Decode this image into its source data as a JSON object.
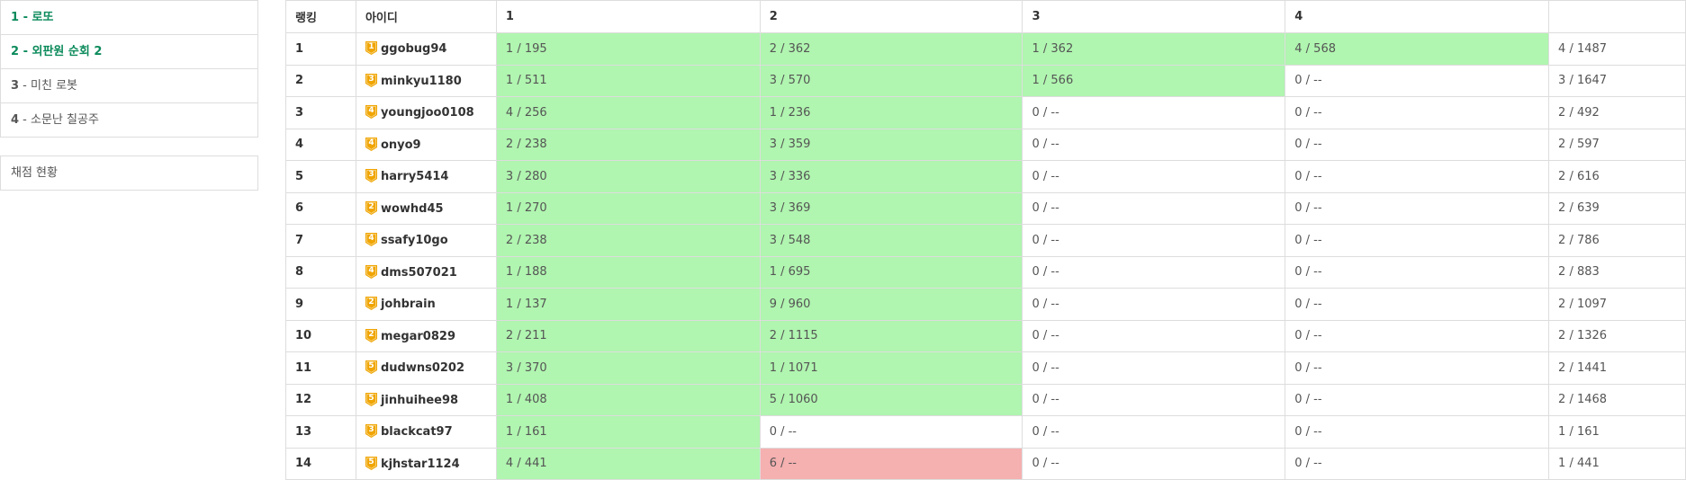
{
  "sidebar": {
    "problems": [
      {
        "num": "1",
        "sep": " - ",
        "title": "로또",
        "solved": true
      },
      {
        "num": "2",
        "sep": " - ",
        "title": "외판원 순회 2",
        "solved": true
      },
      {
        "num": "3",
        "sep": " - ",
        "title": "미친 로봇",
        "solved": false
      },
      {
        "num": "4",
        "sep": " - ",
        "title": "소문난 칠공주",
        "solved": false
      }
    ],
    "status_label": "채점 현황"
  },
  "colors": {
    "accepted": "#b0f5b0",
    "wrong": "#f5b0b0",
    "solved_text": "#0b8a5b",
    "tier_badge": "#f0a500"
  },
  "board": {
    "headers": [
      "랭킹",
      "아이디",
      "1",
      "2",
      "3",
      "4",
      ""
    ],
    "rows": [
      {
        "rank": "1",
        "tier": "1",
        "user": "ggobug94",
        "cells": [
          {
            "text": "1 / 195",
            "status": "ok"
          },
          {
            "text": "2 / 362",
            "status": "ok"
          },
          {
            "text": "1 / 362",
            "status": "ok"
          },
          {
            "text": "4 / 568",
            "status": "ok"
          }
        ],
        "total": "4 / 1487"
      },
      {
        "rank": "2",
        "tier": "3",
        "user": "minkyu1180",
        "cells": [
          {
            "text": "1 / 511",
            "status": "ok"
          },
          {
            "text": "3 / 570",
            "status": "ok"
          },
          {
            "text": "1 / 566",
            "status": "ok"
          },
          {
            "text": "0 / --",
            "status": ""
          }
        ],
        "total": "3 / 1647"
      },
      {
        "rank": "3",
        "tier": "4",
        "user": "youngjoo0108",
        "cells": [
          {
            "text": "4 / 256",
            "status": "ok"
          },
          {
            "text": "1 / 236",
            "status": "ok"
          },
          {
            "text": "0 / --",
            "status": ""
          },
          {
            "text": "0 / --",
            "status": ""
          }
        ],
        "total": "2 / 492"
      },
      {
        "rank": "4",
        "tier": "4",
        "user": "onyo9",
        "cells": [
          {
            "text": "2 / 238",
            "status": "ok"
          },
          {
            "text": "3 / 359",
            "status": "ok"
          },
          {
            "text": "0 / --",
            "status": ""
          },
          {
            "text": "0 / --",
            "status": ""
          }
        ],
        "total": "2 / 597"
      },
      {
        "rank": "5",
        "tier": "3",
        "user": "harry5414",
        "cells": [
          {
            "text": "3 / 280",
            "status": "ok"
          },
          {
            "text": "3 / 336",
            "status": "ok"
          },
          {
            "text": "0 / --",
            "status": ""
          },
          {
            "text": "0 / --",
            "status": ""
          }
        ],
        "total": "2 / 616"
      },
      {
        "rank": "6",
        "tier": "2",
        "user": "wowhd45",
        "cells": [
          {
            "text": "1 / 270",
            "status": "ok"
          },
          {
            "text": "3 / 369",
            "status": "ok"
          },
          {
            "text": "0 / --",
            "status": ""
          },
          {
            "text": "0 / --",
            "status": ""
          }
        ],
        "total": "2 / 639"
      },
      {
        "rank": "7",
        "tier": "4",
        "user": "ssafy10go",
        "cells": [
          {
            "text": "2 / 238",
            "status": "ok"
          },
          {
            "text": "3 / 548",
            "status": "ok"
          },
          {
            "text": "0 / --",
            "status": ""
          },
          {
            "text": "0 / --",
            "status": ""
          }
        ],
        "total": "2 / 786"
      },
      {
        "rank": "8",
        "tier": "4",
        "user": "dms507021",
        "cells": [
          {
            "text": "1 / 188",
            "status": "ok"
          },
          {
            "text": "1 / 695",
            "status": "ok"
          },
          {
            "text": "0 / --",
            "status": ""
          },
          {
            "text": "0 / --",
            "status": ""
          }
        ],
        "total": "2 / 883"
      },
      {
        "rank": "9",
        "tier": "2",
        "user": "johbrain",
        "cells": [
          {
            "text": "1 / 137",
            "status": "ok"
          },
          {
            "text": "9 / 960",
            "status": "ok"
          },
          {
            "text": "0 / --",
            "status": ""
          },
          {
            "text": "0 / --",
            "status": ""
          }
        ],
        "total": "2 / 1097"
      },
      {
        "rank": "10",
        "tier": "2",
        "user": "megar0829",
        "cells": [
          {
            "text": "2 / 211",
            "status": "ok"
          },
          {
            "text": "2 / 1115",
            "status": "ok"
          },
          {
            "text": "0 / --",
            "status": ""
          },
          {
            "text": "0 / --",
            "status": ""
          }
        ],
        "total": "2 / 1326"
      },
      {
        "rank": "11",
        "tier": "5",
        "user": "dudwns0202",
        "cells": [
          {
            "text": "3 / 370",
            "status": "ok"
          },
          {
            "text": "1 / 1071",
            "status": "ok"
          },
          {
            "text": "0 / --",
            "status": ""
          },
          {
            "text": "0 / --",
            "status": ""
          }
        ],
        "total": "2 / 1441"
      },
      {
        "rank": "12",
        "tier": "5",
        "user": "jinhuihee98",
        "cells": [
          {
            "text": "1 / 408",
            "status": "ok"
          },
          {
            "text": "5 / 1060",
            "status": "ok"
          },
          {
            "text": "0 / --",
            "status": ""
          },
          {
            "text": "0 / --",
            "status": ""
          }
        ],
        "total": "2 / 1468"
      },
      {
        "rank": "13",
        "tier": "3",
        "user": "blackcat97",
        "cells": [
          {
            "text": "1 / 161",
            "status": "ok"
          },
          {
            "text": "0 / --",
            "status": ""
          },
          {
            "text": "0 / --",
            "status": ""
          },
          {
            "text": "0 / --",
            "status": ""
          }
        ],
        "total": "1 / 161"
      },
      {
        "rank": "14",
        "tier": "5",
        "user": "kjhstar1124",
        "cells": [
          {
            "text": "4 / 441",
            "status": "ok"
          },
          {
            "text": "6 / --",
            "status": "fail"
          },
          {
            "text": "0 / --",
            "status": ""
          },
          {
            "text": "0 / --",
            "status": ""
          }
        ],
        "total": "1 / 441"
      }
    ]
  }
}
